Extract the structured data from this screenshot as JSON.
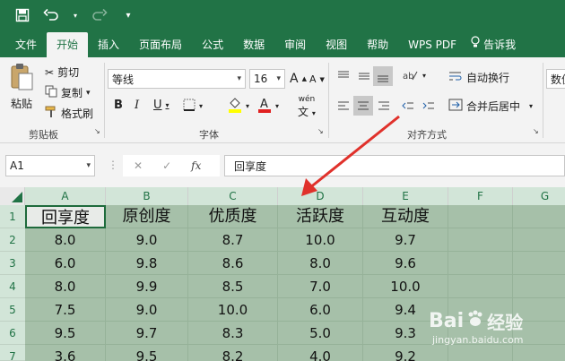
{
  "quick_access": {
    "save_icon": "save-icon",
    "undo_icon": "undo-icon",
    "redo_icon": "redo-icon",
    "customize_icon": "chevron-down-icon"
  },
  "tabs": [
    {
      "label": "文件"
    },
    {
      "label": "开始",
      "active": true
    },
    {
      "label": "插入"
    },
    {
      "label": "页面布局"
    },
    {
      "label": "公式"
    },
    {
      "label": "数据"
    },
    {
      "label": "审阅"
    },
    {
      "label": "视图"
    },
    {
      "label": "帮助"
    },
    {
      "label": "WPS PDF"
    },
    {
      "label": "告诉我"
    }
  ],
  "ribbon": {
    "paste": "粘贴",
    "cut": "剪切",
    "copy": "复制",
    "format_painter": "格式刷",
    "clipboard_group": "剪贴板",
    "font_name": "等线",
    "font_size": "16",
    "font_group": "字体",
    "phonetic": "wén",
    "wrap_text": "自动换行",
    "merge_center": "合并后居中",
    "alignment_group": "对齐方式",
    "number_format": "数值"
  },
  "formula_bar": {
    "name_box": "A1",
    "fx": "fx",
    "content": "回享度"
  },
  "columns": [
    "A",
    "B",
    "C",
    "D",
    "E",
    "F",
    "G"
  ],
  "rows": [
    "1",
    "2",
    "3",
    "4",
    "5",
    "6",
    "7"
  ],
  "table": {
    "headers": [
      "回享度",
      "原创度",
      "优质度",
      "活跃度",
      "互动度"
    ],
    "rows": [
      [
        "8.0",
        "9.0",
        "8.7",
        "10.0",
        "9.7"
      ],
      [
        "6.0",
        "9.8",
        "8.6",
        "8.0",
        "9.6"
      ],
      [
        "8.0",
        "9.9",
        "8.5",
        "7.0",
        "10.0"
      ],
      [
        "7.5",
        "9.0",
        "10.0",
        "6.0",
        "9.4"
      ],
      [
        "9.5",
        "9.7",
        "8.3",
        "5.0",
        "9.3"
      ],
      [
        "3.6",
        "9.5",
        "8.2",
        "4.0",
        "9.2"
      ]
    ]
  },
  "watermark": {
    "brand": "Bai",
    "brand2": "经验",
    "url": "jingyan.baidu.com"
  },
  "colors": {
    "excel_green": "#217346",
    "selection": "#a6c0a9",
    "arrow": "#e0312b"
  }
}
